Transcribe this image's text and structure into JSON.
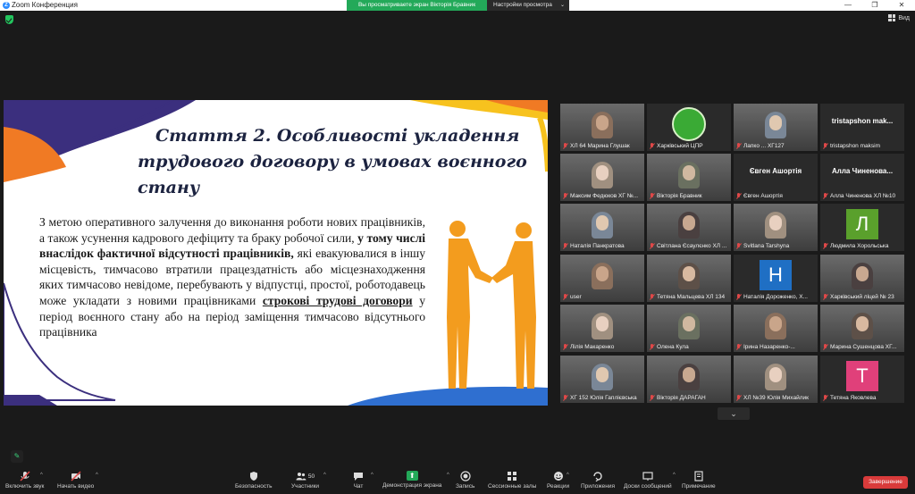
{
  "window": {
    "title": "Zoom Конференция",
    "app_icon_letter": "Z",
    "share_banner": "Вы просматриваете экран Вікторія Бравник",
    "view_options": "Настройки просмотра",
    "view_button": "Вид"
  },
  "slide": {
    "title_line1": "Стаття 2. Особливості укладення",
    "title_line2": "трудового договору в умовах воєнного стану",
    "body_part1": "З метою оперативного залучення до виконання роботи нових працівників, а також усунення кадрового дефіциту та браку робочої сили,",
    "body_bold": "у тому числі внаслідок фактичної відсутності працівників,",
    "body_part2": "які евакуювалися в іншу місцевість, тимчасово втратили працездатність або місцезнаходження яких тимчасово невідоме, перебувають у відпустці, простої, роботодавець може укладати з новими працівниками",
    "body_underline": "строкові трудові договори",
    "body_part3": "у період воєнного стану або на період заміщення тимчасово відсутнього працівника"
  },
  "participants": [
    {
      "name": "ХЛ 64 Марина Глушак",
      "kind": "photo"
    },
    {
      "name": "Харківський ЦПР",
      "kind": "logo"
    },
    {
      "name": "Лапко ... ХГ127",
      "kind": "photo"
    },
    {
      "name": "tristapshon maksim",
      "kind": "text",
      "display": "tristapshon mak..."
    },
    {
      "name": "Максим Федюков ХГ №...",
      "kind": "photo"
    },
    {
      "name": "Вікторія Бравник",
      "kind": "photo",
      "active": true
    },
    {
      "name": "Євген Ашортія",
      "kind": "text",
      "display": "Євген Ашортія"
    },
    {
      "name": "Алла Чиненова ХЛ №10",
      "kind": "text",
      "display": "Алла Чиненова..."
    },
    {
      "name": "Наталія Панкратова",
      "kind": "photo"
    },
    {
      "name": "Світлана Єсаулєнко ХЛ ...",
      "kind": "photo"
    },
    {
      "name": "Svitlana Tarshyna",
      "kind": "photo"
    },
    {
      "name": "Людмила Хорольська",
      "kind": "letter",
      "letter": "Л",
      "color": "#5aa02c"
    },
    {
      "name": "user",
      "kind": "photo"
    },
    {
      "name": "Тетяна Мальцева ХЛ 134",
      "kind": "photo"
    },
    {
      "name": "Наталія Дороженко, Х...",
      "kind": "letter",
      "letter": "Н",
      "color": "#1f6fc4"
    },
    {
      "name": "Харківський ліцей № 23",
      "kind": "photo"
    },
    {
      "name": "Лілія Макаренко",
      "kind": "photo"
    },
    {
      "name": "Олена Кула",
      "kind": "photo"
    },
    {
      "name": "Ірина Назаренко-...",
      "kind": "photo"
    },
    {
      "name": "Марина Сушенцова ХГ...",
      "kind": "photo"
    },
    {
      "name": "ХГ 152 Юлія Гаплієвська",
      "kind": "photo"
    },
    {
      "name": "Вікторія ДАРАГАН",
      "kind": "photo"
    },
    {
      "name": "ХЛ №39 Юлія Михайлик",
      "kind": "photo"
    },
    {
      "name": "Тетяна Яковлева",
      "kind": "letter",
      "letter": "Т",
      "color": "#e0407a"
    }
  ],
  "toolbar": {
    "audio": "Включить звук",
    "video": "Начать видео",
    "security": "Безопасность",
    "participants": "Участники",
    "participants_count": "50",
    "chat": "Чат",
    "share": "Демонстрация экрана",
    "record": "Запись",
    "breakout": "Сессионные залы",
    "reactions": "Реакции",
    "apps": "Приложения",
    "whiteboards": "Доски сообщений",
    "notes": "Примечание",
    "end": "Завершение"
  }
}
